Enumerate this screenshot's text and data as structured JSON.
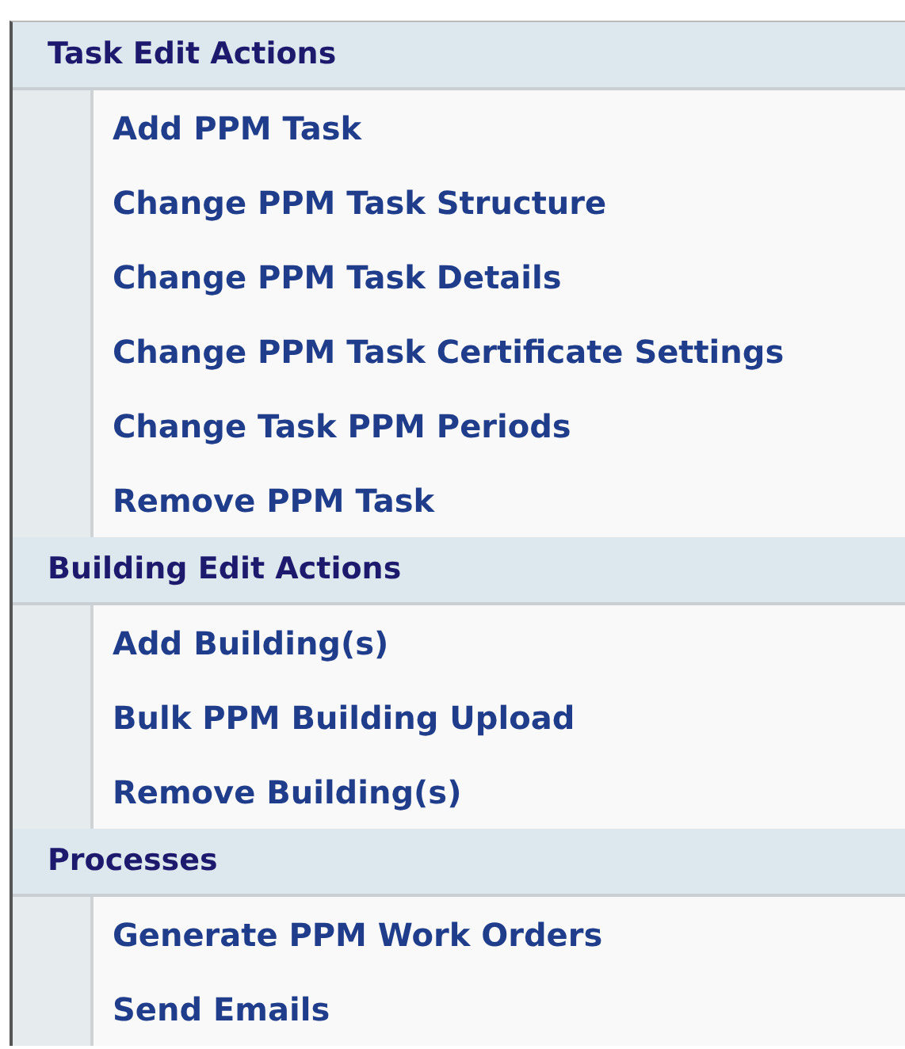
{
  "sections": [
    {
      "title": "Task Edit Actions",
      "items": [
        "Add PPM Task",
        "Change PPM Task Structure",
        "Change PPM Task Details",
        "Change PPM Task Certificate Settings",
        "Change Task PPM Periods",
        "Remove PPM Task"
      ]
    },
    {
      "title": "Building Edit Actions",
      "items": [
        "Add Building(s)",
        "Bulk PPM Building Upload",
        "Remove Building(s)"
      ]
    },
    {
      "title": "Processes",
      "items": [
        "Generate PPM Work Orders",
        "Send Emails"
      ]
    }
  ]
}
